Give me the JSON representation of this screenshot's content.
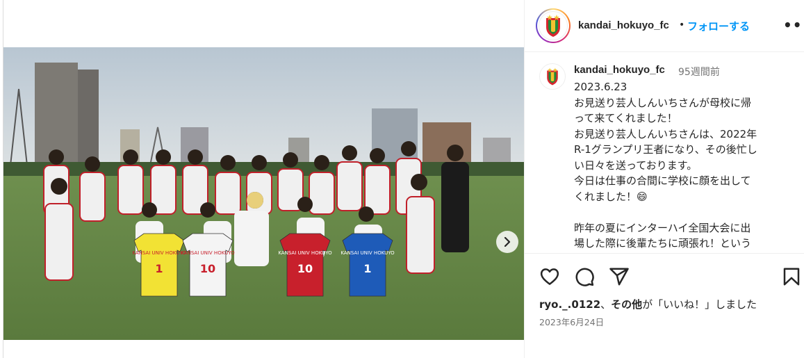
{
  "post": {
    "username": "kandai_hokuyo_fc",
    "separator": "•",
    "follow_label": "フォローする",
    "more_label": "•••"
  },
  "caption": {
    "username": "kandai_hokuyo_fc",
    "relative_time": "95週間前",
    "lines": [
      "2023.6.23",
      "お見送り芸人しんいちさんが母校に帰",
      "って来てくれました！",
      "お見送り芸人しんいちさんは、2022年",
      "R-1グランプリ王者になり、その後忙し",
      "い日々を送っております。",
      "今日は仕事の合間に学校に顔を出して",
      "くれました！😄",
      "",
      "昨年の夏にインターハイ全国大会に出",
      "場した際に後輩たちに頑張れ！という"
    ]
  },
  "likes": {
    "user": "ryo._.0122",
    "sep": "、",
    "others": "その他",
    "suffix": "が「いいね！」しました"
  },
  "date": "2023年6月24日",
  "media": {
    "jerseys": [
      {
        "text": "KANSAI UNIV HOKUYO",
        "number": "1",
        "color": "#f2e234"
      },
      {
        "text": "KANSAI UNIV HOKUYO",
        "number": "10",
        "color": "#f4f4f4"
      },
      {
        "text": "KANSAI UNIV HOKUYO",
        "number": "10",
        "color": "#c8202c"
      },
      {
        "text": "KANSAI UNIV HOKUYO",
        "number": "1",
        "color": "#1e5bb8"
      }
    ],
    "carousel_dot_count": 7,
    "active_dot": 0
  },
  "icons": {
    "like": "heart-icon",
    "comment": "comment-icon",
    "share": "share-icon",
    "save": "bookmark-icon",
    "next": "chevron-right-icon"
  },
  "colors": {
    "follow": "#0095f6",
    "text": "#262626",
    "muted": "#737373"
  }
}
